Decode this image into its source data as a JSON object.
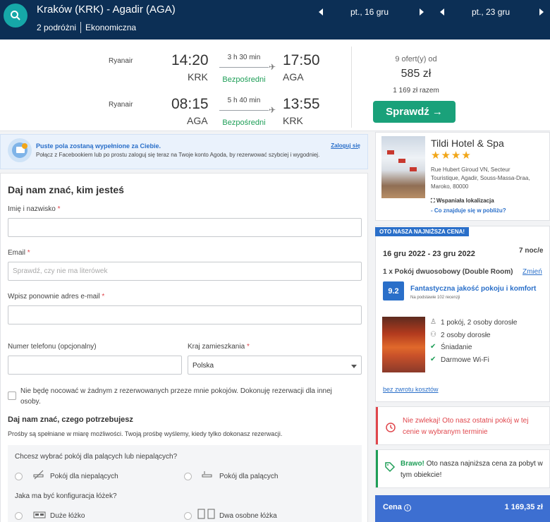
{
  "search": {
    "route": "Kraków (KRK) - Agadir (AGA)",
    "travellers": "2 podróżni",
    "cabin": "Ekonomiczna",
    "date_out": "pt., 16 gru",
    "date_back": "pt., 23 gru"
  },
  "flights": [
    {
      "airline": "Ryanair",
      "dep_time": "14:20",
      "dep_code": "KRK",
      "duration": "3 h 30 min",
      "stops": "Bezpośredni",
      "arr_time": "17:50",
      "arr_code": "AGA"
    },
    {
      "airline": "Ryanair",
      "dep_time": "08:15",
      "dep_code": "AGA",
      "duration": "5 h 40 min",
      "stops": "Bezpośredni",
      "arr_time": "13:55",
      "arr_code": "KRK"
    }
  ],
  "offer": {
    "offers_label": "9 ofert(y) od",
    "price": "585 zł",
    "total": "1 169 zł razem",
    "cta": "Sprawdź →"
  },
  "fb_banner": {
    "title": "Puste pola zostaną wypełnione za Ciebie.",
    "text": "Połącz z Facebookiem lub po prostu zaloguj się teraz na Twoje konto Agoda, by rezerwować szybciej i wygodniej.",
    "login": "Zaloguj się"
  },
  "form": {
    "title": "Daj nam znać, kim jesteś",
    "name_label": "Imię i nazwisko",
    "email_label": "Email",
    "email_placeholder": "Sprawdź, czy nie ma literówek",
    "email2_label": "Wpisz ponownie adres e-mail",
    "phone_label": "Numer telefonu (opcjonalny)",
    "country_label": "Kraj zamieszkania",
    "country_value": "Polska",
    "required_mark": "*",
    "nocheckin_line1": "Nie będę nocować w żadnym z rezerwowanych przeze mnie pokojów. Dokonuję rezerwacji dla innej",
    "nocheckin_line2": "osoby.",
    "needs_title": "Daj nam znać, czego potrzebujesz",
    "needs_text": "Prośby są spełniane w miarę możliwości. Twoją prośbę wyślemy, kiedy tylko dokonasz rezerwacji.",
    "smoking_q": "Chcesz wybrać pokój dla palących lub niepalących?",
    "nonsmoking": "Pokój dla niepalących",
    "smoking": "Pokój dla palących",
    "bed_q": "Jaka ma być konfiguracja łóżek?",
    "big_bed": "Duże łóżko",
    "twin_beds": "Dwa osobne łóżka"
  },
  "hotel": {
    "name": "Tildi Hotel & Spa",
    "stars": "★★★★",
    "address_line1": "Rue Hubert Giroud VN, Secteur",
    "address_line2": "Touristique, Agadir, Souss-Massa-Draa,",
    "address_line3": "Maroko, 80000",
    "location": "Wspaniała lokalizacja",
    "nearby": "- Co znajduje się w pobliżu?"
  },
  "booking": {
    "tag": "OTO NASZA NAJNIŻSZA CENA!",
    "dates": "16 gru 2022 - 23 gru 2022",
    "nights": "7 noc/e",
    "room": "1 x Pokój dwuosobowy (Double Room)",
    "change": "Zmień",
    "score": "9.2",
    "score_text": "Fantastyczna jakość pokoju i komfort",
    "score_sub": "Na podstawie 102 recenzji",
    "amenities": [
      "1 pokój, 2 osoby dorosłe",
      "2 osoby dorosłe",
      "Śniadanie",
      "Darmowe Wi-Fi"
    ],
    "refund": "bez zwrotu kosztów"
  },
  "alerts": {
    "last_room": "Nie zwlekaj! Oto nasz ostatni pokój w tej cenie w wybranym terminie",
    "bravo_strong": "Brawo!",
    "bravo_text": "Oto nasza najniższa cena za pobyt w tym obiekcie!"
  },
  "price_bar": {
    "label": "Cena",
    "value": "1 169,35 zł"
  },
  "colors": {
    "header": "#0c2f55",
    "accent": "#1aa17a",
    "link": "#2a6fc9",
    "alert_red": "#e0464c",
    "success_green": "#1e9e57"
  }
}
